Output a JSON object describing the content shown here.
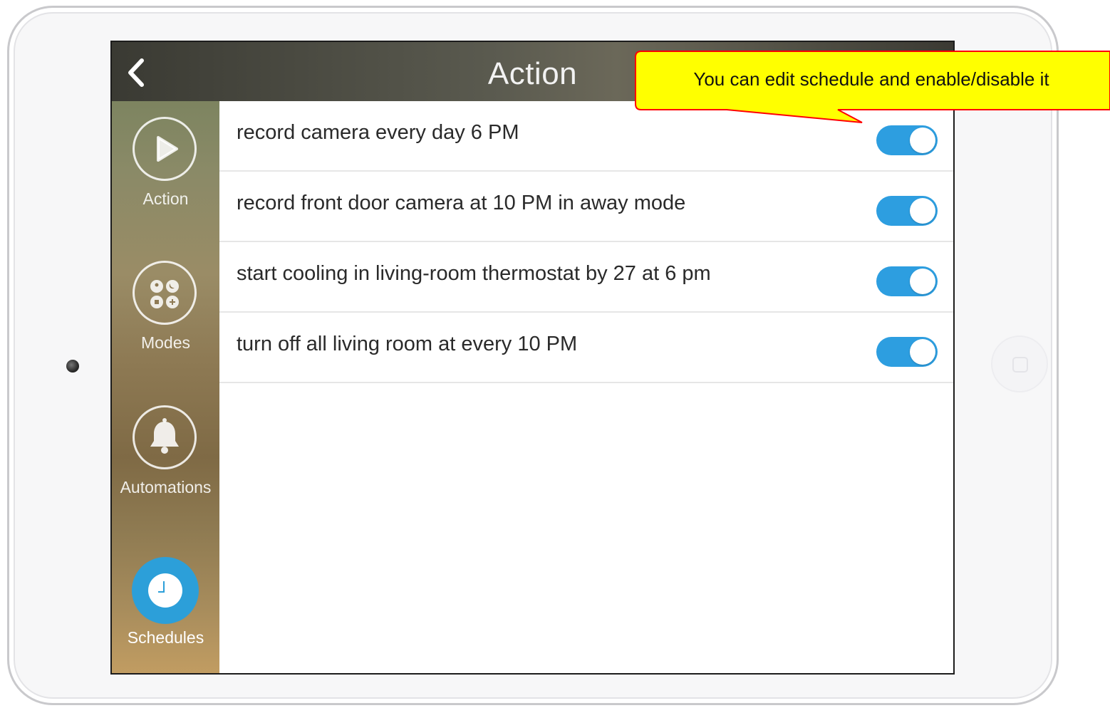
{
  "header": {
    "title": "Action",
    "back_icon": "chevron-left-icon"
  },
  "sidebar": {
    "items": [
      {
        "label": "Action",
        "icon": "play-icon",
        "active": false
      },
      {
        "label": "Modes",
        "icon": "modes-icon",
        "active": false
      },
      {
        "label": "Automations",
        "icon": "bell-icon",
        "active": false
      },
      {
        "label": "Schedules",
        "icon": "clock-icon",
        "active": true
      }
    ]
  },
  "schedules": [
    {
      "label": "record camera every day 6 PM",
      "enabled": true
    },
    {
      "label": "record front door camera at 10 PM in away mode",
      "enabled": true
    },
    {
      "label": "start cooling in living-room thermostat by 27 at 6 pm",
      "enabled": true
    },
    {
      "label": "turn off all living room at every 10 PM",
      "enabled": true
    }
  ],
  "callout": {
    "text": "You can edit schedule and enable/disable it",
    "background": "#ffff00",
    "border": "#ff0000"
  },
  "colors": {
    "accent": "#2d9ee0",
    "active_nav": "#2c9fd9"
  }
}
